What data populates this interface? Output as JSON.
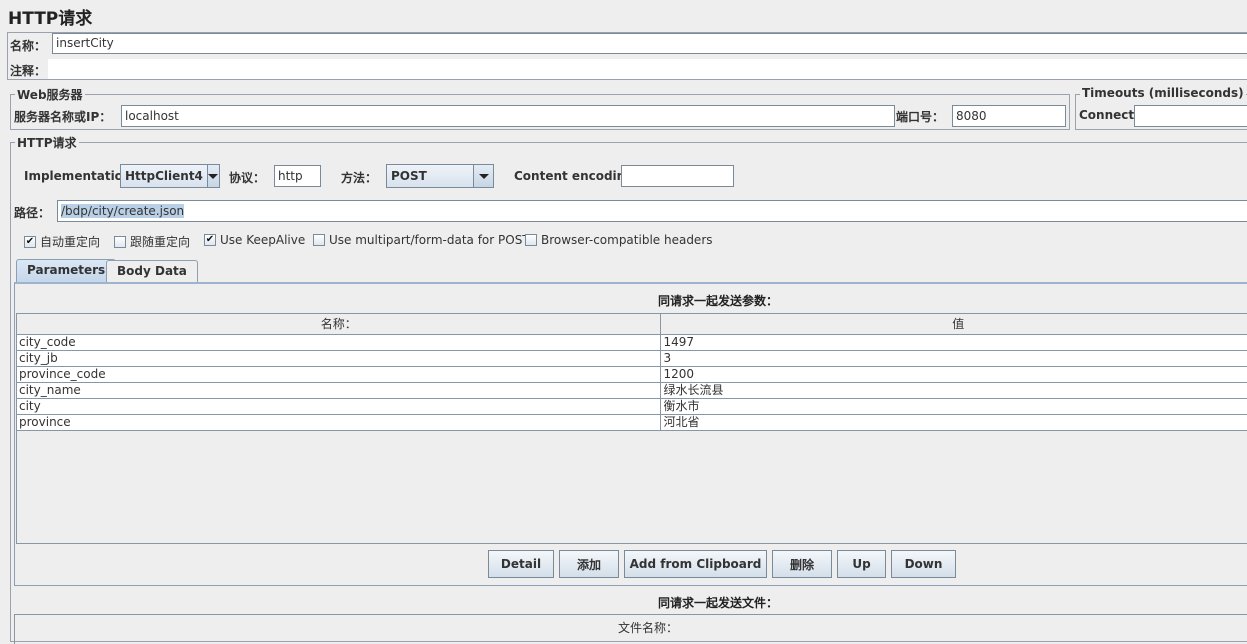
{
  "window": {
    "title": "HTTP请求"
  },
  "name_field": {
    "label": "名称：",
    "value": "insertCity"
  },
  "comment_field": {
    "label": "注释：",
    "value": ""
  },
  "web_server": {
    "legend": "Web服务器",
    "server_label": "服务器名称或IP：",
    "server_value": "localhost",
    "port_label": "端口号：",
    "port_value": "8080"
  },
  "timeouts": {
    "legend": "Timeouts (milliseconds)",
    "connect_label": "Connect:",
    "connect_value": ""
  },
  "http_request": {
    "legend": "HTTP请求",
    "implementation_label": "Implementation:",
    "implementation_value": "HttpClient4",
    "protocol_label": "协议：",
    "protocol_value": "http",
    "method_label": "方法：",
    "method_value": "POST",
    "encoding_label": "Content encoding:",
    "encoding_value": "",
    "path_label": "路径：",
    "path_value": "/bdp/city/create.json"
  },
  "options": [
    {
      "label": "自动重定向",
      "checked": true
    },
    {
      "label": "跟随重定向",
      "checked": false
    },
    {
      "label": "Use KeepAlive",
      "checked": true
    },
    {
      "label": "Use multipart/form-data for POST",
      "checked": false
    },
    {
      "label": "Browser-compatible headers",
      "checked": false
    }
  ],
  "tabs": [
    {
      "label": "Parameters",
      "active": true
    },
    {
      "label": "Body Data",
      "active": false
    }
  ],
  "parameters": {
    "title": "同请求一起发送参数：",
    "columns": [
      "名称：",
      "值"
    ],
    "rows": [
      [
        "city_code",
        "1497"
      ],
      [
        "city_jb",
        "3"
      ],
      [
        "province_code",
        "1200"
      ],
      [
        "city_name",
        "绿水长流县"
      ],
      [
        "city",
        "衡水市"
      ],
      [
        "province",
        "河北省"
      ]
    ]
  },
  "buttons": {
    "detail": "Detail",
    "add": "添加",
    "add_clipboard": "Add from Clipboard",
    "delete": "删除",
    "up": "Up",
    "down": "Down"
  },
  "files": {
    "title": "同请求一起发送文件：",
    "column_filename": "文件名称："
  }
}
